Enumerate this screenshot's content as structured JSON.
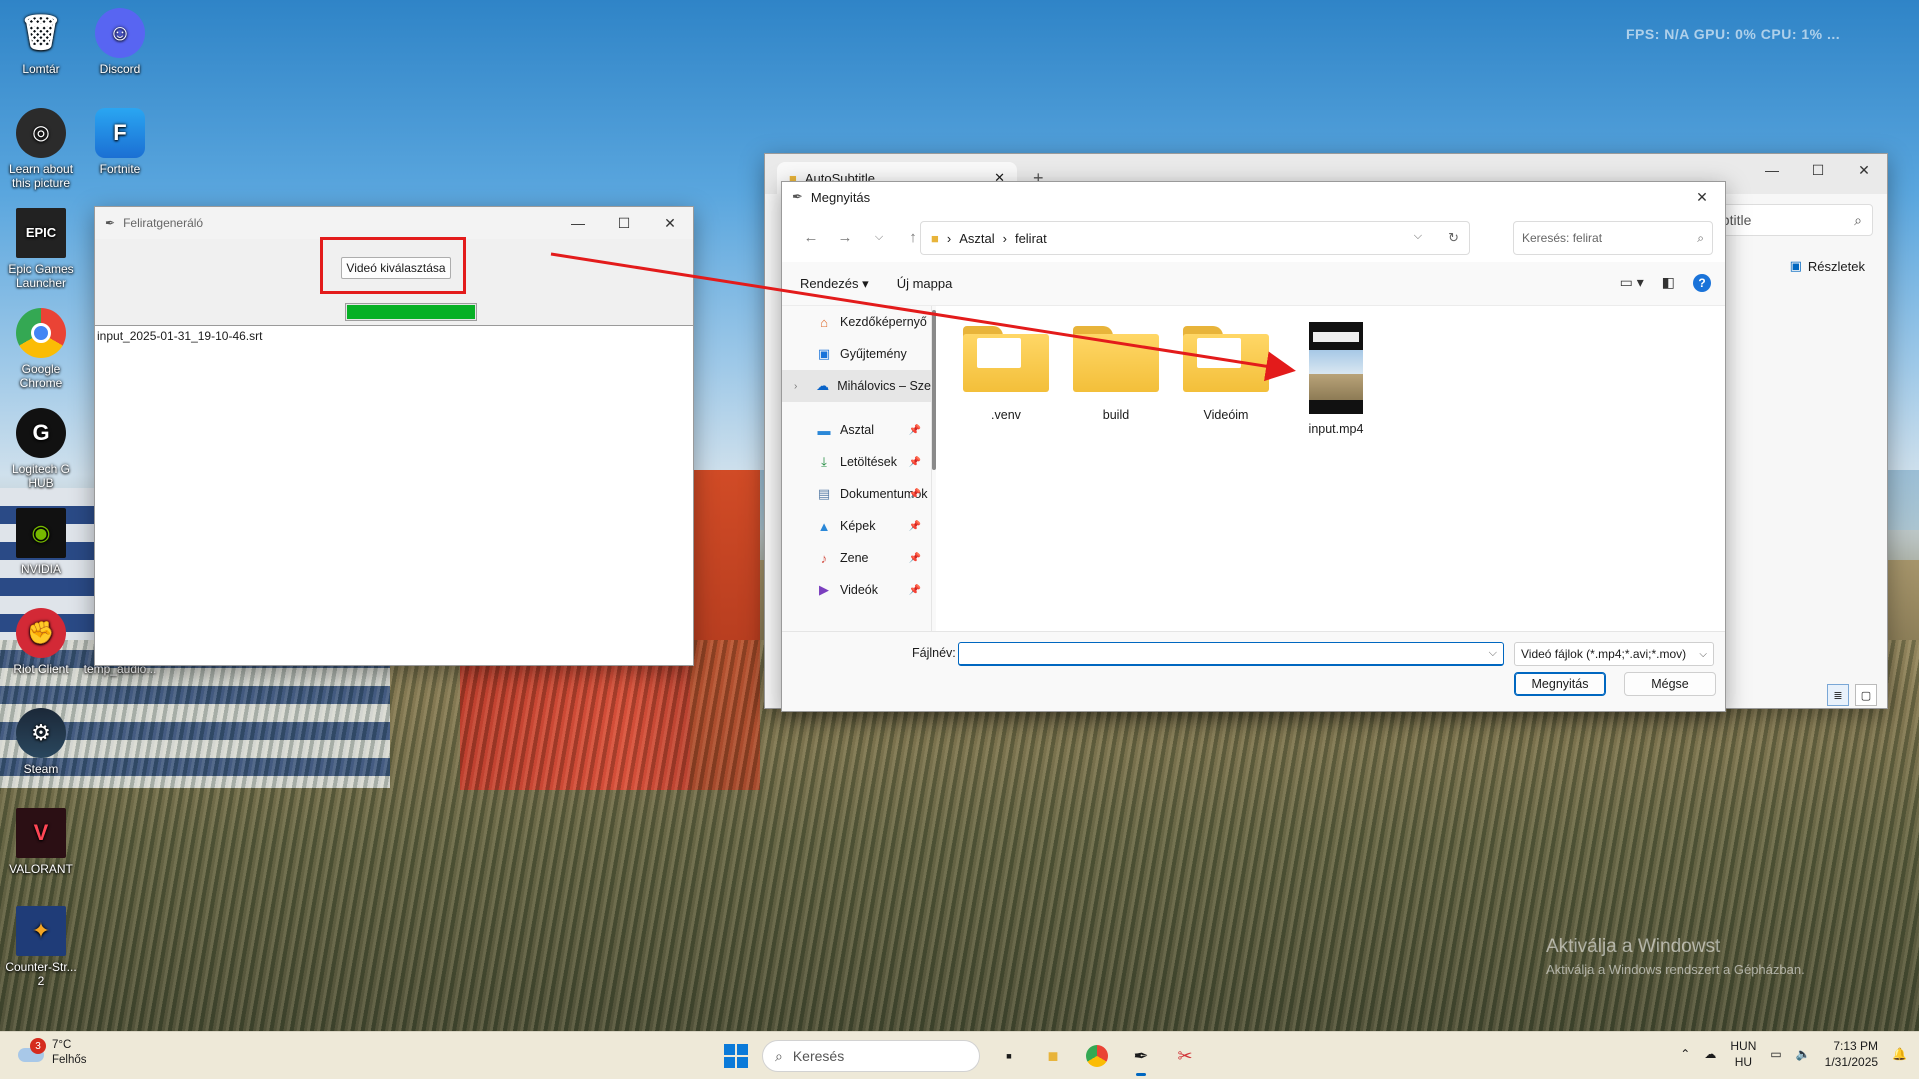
{
  "desktop": {
    "overlay_text": "FPS: N/A GPU: 0% CPU: 1% ...",
    "icons": [
      {
        "label": "Lomtár",
        "icon": "recycle-bin-icon"
      },
      {
        "label": "Discord",
        "icon": "discord-icon"
      },
      {
        "label": "Learn about this picture",
        "icon": "camera-icon"
      },
      {
        "label": "Fortnite",
        "icon": "fortnite-icon"
      },
      {
        "label": "Epic Games Launcher",
        "icon": "epic-games-icon"
      },
      {
        "label": "Google Chrome",
        "icon": "chrome-icon"
      },
      {
        "label": "Logitech G HUB",
        "icon": "logitech-icon"
      },
      {
        "label": "NVIDIA",
        "icon": "nvidia-icon"
      },
      {
        "label": "Riot Client",
        "icon": "riot-icon"
      },
      {
        "label": "temp_audio...",
        "icon": "audio-file-icon"
      },
      {
        "label": "Steam",
        "icon": "steam-icon"
      },
      {
        "label": "VALORANT",
        "icon": "valorant-icon"
      },
      {
        "label": "Counter-Str... 2",
        "icon": "counter-strike-icon"
      }
    ],
    "watermark": {
      "line1": "Aktiválja a Windowst",
      "line2": "Aktiválja a Windows rendszert a Gépházban."
    }
  },
  "app": {
    "title": "Feliratgeneráló",
    "select_button": "Videó kiválasztása",
    "progress": 1.0,
    "output_text": "input_2025-01-31_19-10-46.srt"
  },
  "explorer": {
    "tab_title": "AutoSubtitle",
    "search_partial": "ubtitle",
    "details_label": "Részletek"
  },
  "dialog": {
    "title": "Megnyitás",
    "breadcrumb": [
      "Asztal",
      "felirat"
    ],
    "search_placeholder": "Keresés: felirat",
    "commands": {
      "organize": "Rendezés",
      "new_folder": "Új mappa"
    },
    "nav_items": [
      {
        "label": "Kezdőképernyő",
        "icon": "home-icon"
      },
      {
        "label": "Gyűjtemény",
        "icon": "gallery-icon"
      },
      {
        "label": "Mihálovics – Sze",
        "icon": "onedrive-icon"
      },
      {
        "label": "Asztal",
        "icon": "desktop-icon"
      },
      {
        "label": "Letöltések",
        "icon": "download-icon"
      },
      {
        "label": "Dokumentumok",
        "icon": "document-icon"
      },
      {
        "label": "Képek",
        "icon": "pictures-icon"
      },
      {
        "label": "Zene",
        "icon": "music-icon"
      },
      {
        "label": "Videók",
        "icon": "videos-icon"
      }
    ],
    "files": [
      {
        "name": ".venv",
        "type": "folder"
      },
      {
        "name": "build",
        "type": "folder"
      },
      {
        "name": "Videóim",
        "type": "folder"
      },
      {
        "name": "input.mp4",
        "type": "video"
      }
    ],
    "filename_label": "Fájlnév:",
    "filename_value": "",
    "filetype": "Videó fájlok (*.mp4;*.avi;*.mov)",
    "open_button": "Megnyitás",
    "cancel_button": "Mégse"
  },
  "taskbar": {
    "weather_temp": "7°C",
    "weather_desc": "Felhős",
    "weather_badge": "3",
    "search_placeholder": "Keresés",
    "lang_top": "HUN",
    "lang_bottom": "HU",
    "time": "7:13 PM",
    "date": "1/31/2025"
  },
  "colors": {
    "accent": "#0067c0",
    "progress": "#06b025",
    "annotation": "#e31b1b"
  }
}
